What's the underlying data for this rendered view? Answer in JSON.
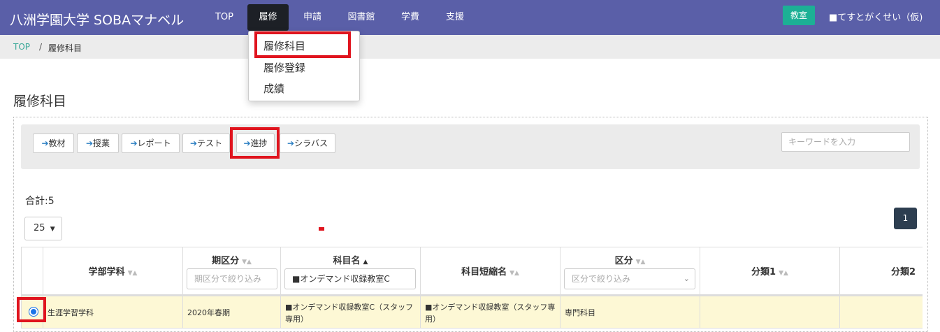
{
  "app": {
    "title": "八洲学園大学 SOBAマナベル"
  },
  "nav": {
    "items": [
      {
        "label": "TOP"
      },
      {
        "label": "履修"
      },
      {
        "label": "申請"
      },
      {
        "label": "図書館"
      },
      {
        "label": "学費"
      },
      {
        "label": "支援"
      }
    ],
    "active": "履修",
    "classroom_button": "教室",
    "user": "■てすとがくせい（仮)"
  },
  "breadcrumb": {
    "home": "TOP",
    "separator": "/",
    "current": "履修科目"
  },
  "dropdown": {
    "items": [
      "履修科目",
      "履修登録",
      "成績"
    ]
  },
  "page": {
    "title": "履修科目"
  },
  "toolbar": {
    "buttons": [
      {
        "label": "教材"
      },
      {
        "label": "授業"
      },
      {
        "label": "レポート"
      },
      {
        "label": "テスト"
      },
      {
        "label": "進捗"
      },
      {
        "label": "シラバス"
      }
    ],
    "arrow": "➔",
    "search_placeholder": "キーワードを入力"
  },
  "list": {
    "total_label": "合計:5",
    "per_page": "25",
    "page": "1"
  },
  "table": {
    "headers": {
      "department": "学部学科",
      "term": "期区分",
      "course": "科目名",
      "short_name": "科目短縮名",
      "category": "区分",
      "class1": "分類1",
      "class2": "分類2"
    },
    "filters": {
      "term_placeholder": "期区分で絞り込み",
      "course_value": "■オンデマンド収録教室C",
      "category_placeholder": "区分で絞り込み"
    },
    "rows": [
      {
        "department": "生涯学習学科",
        "term": "2020年春期",
        "course": "■オンデマンド収録教室C（スタッフ専用）",
        "short_name": "■オンデマンド収録教室（スタッフ専用）",
        "category": "専門科目",
        "class1": "",
        "class2": "",
        "selected": true
      }
    ]
  },
  "colors": {
    "navbar": "#5a5fa8",
    "accent": "#1cb095",
    "highlight": "#e0141e",
    "selected_row": "#fdf8d5"
  }
}
